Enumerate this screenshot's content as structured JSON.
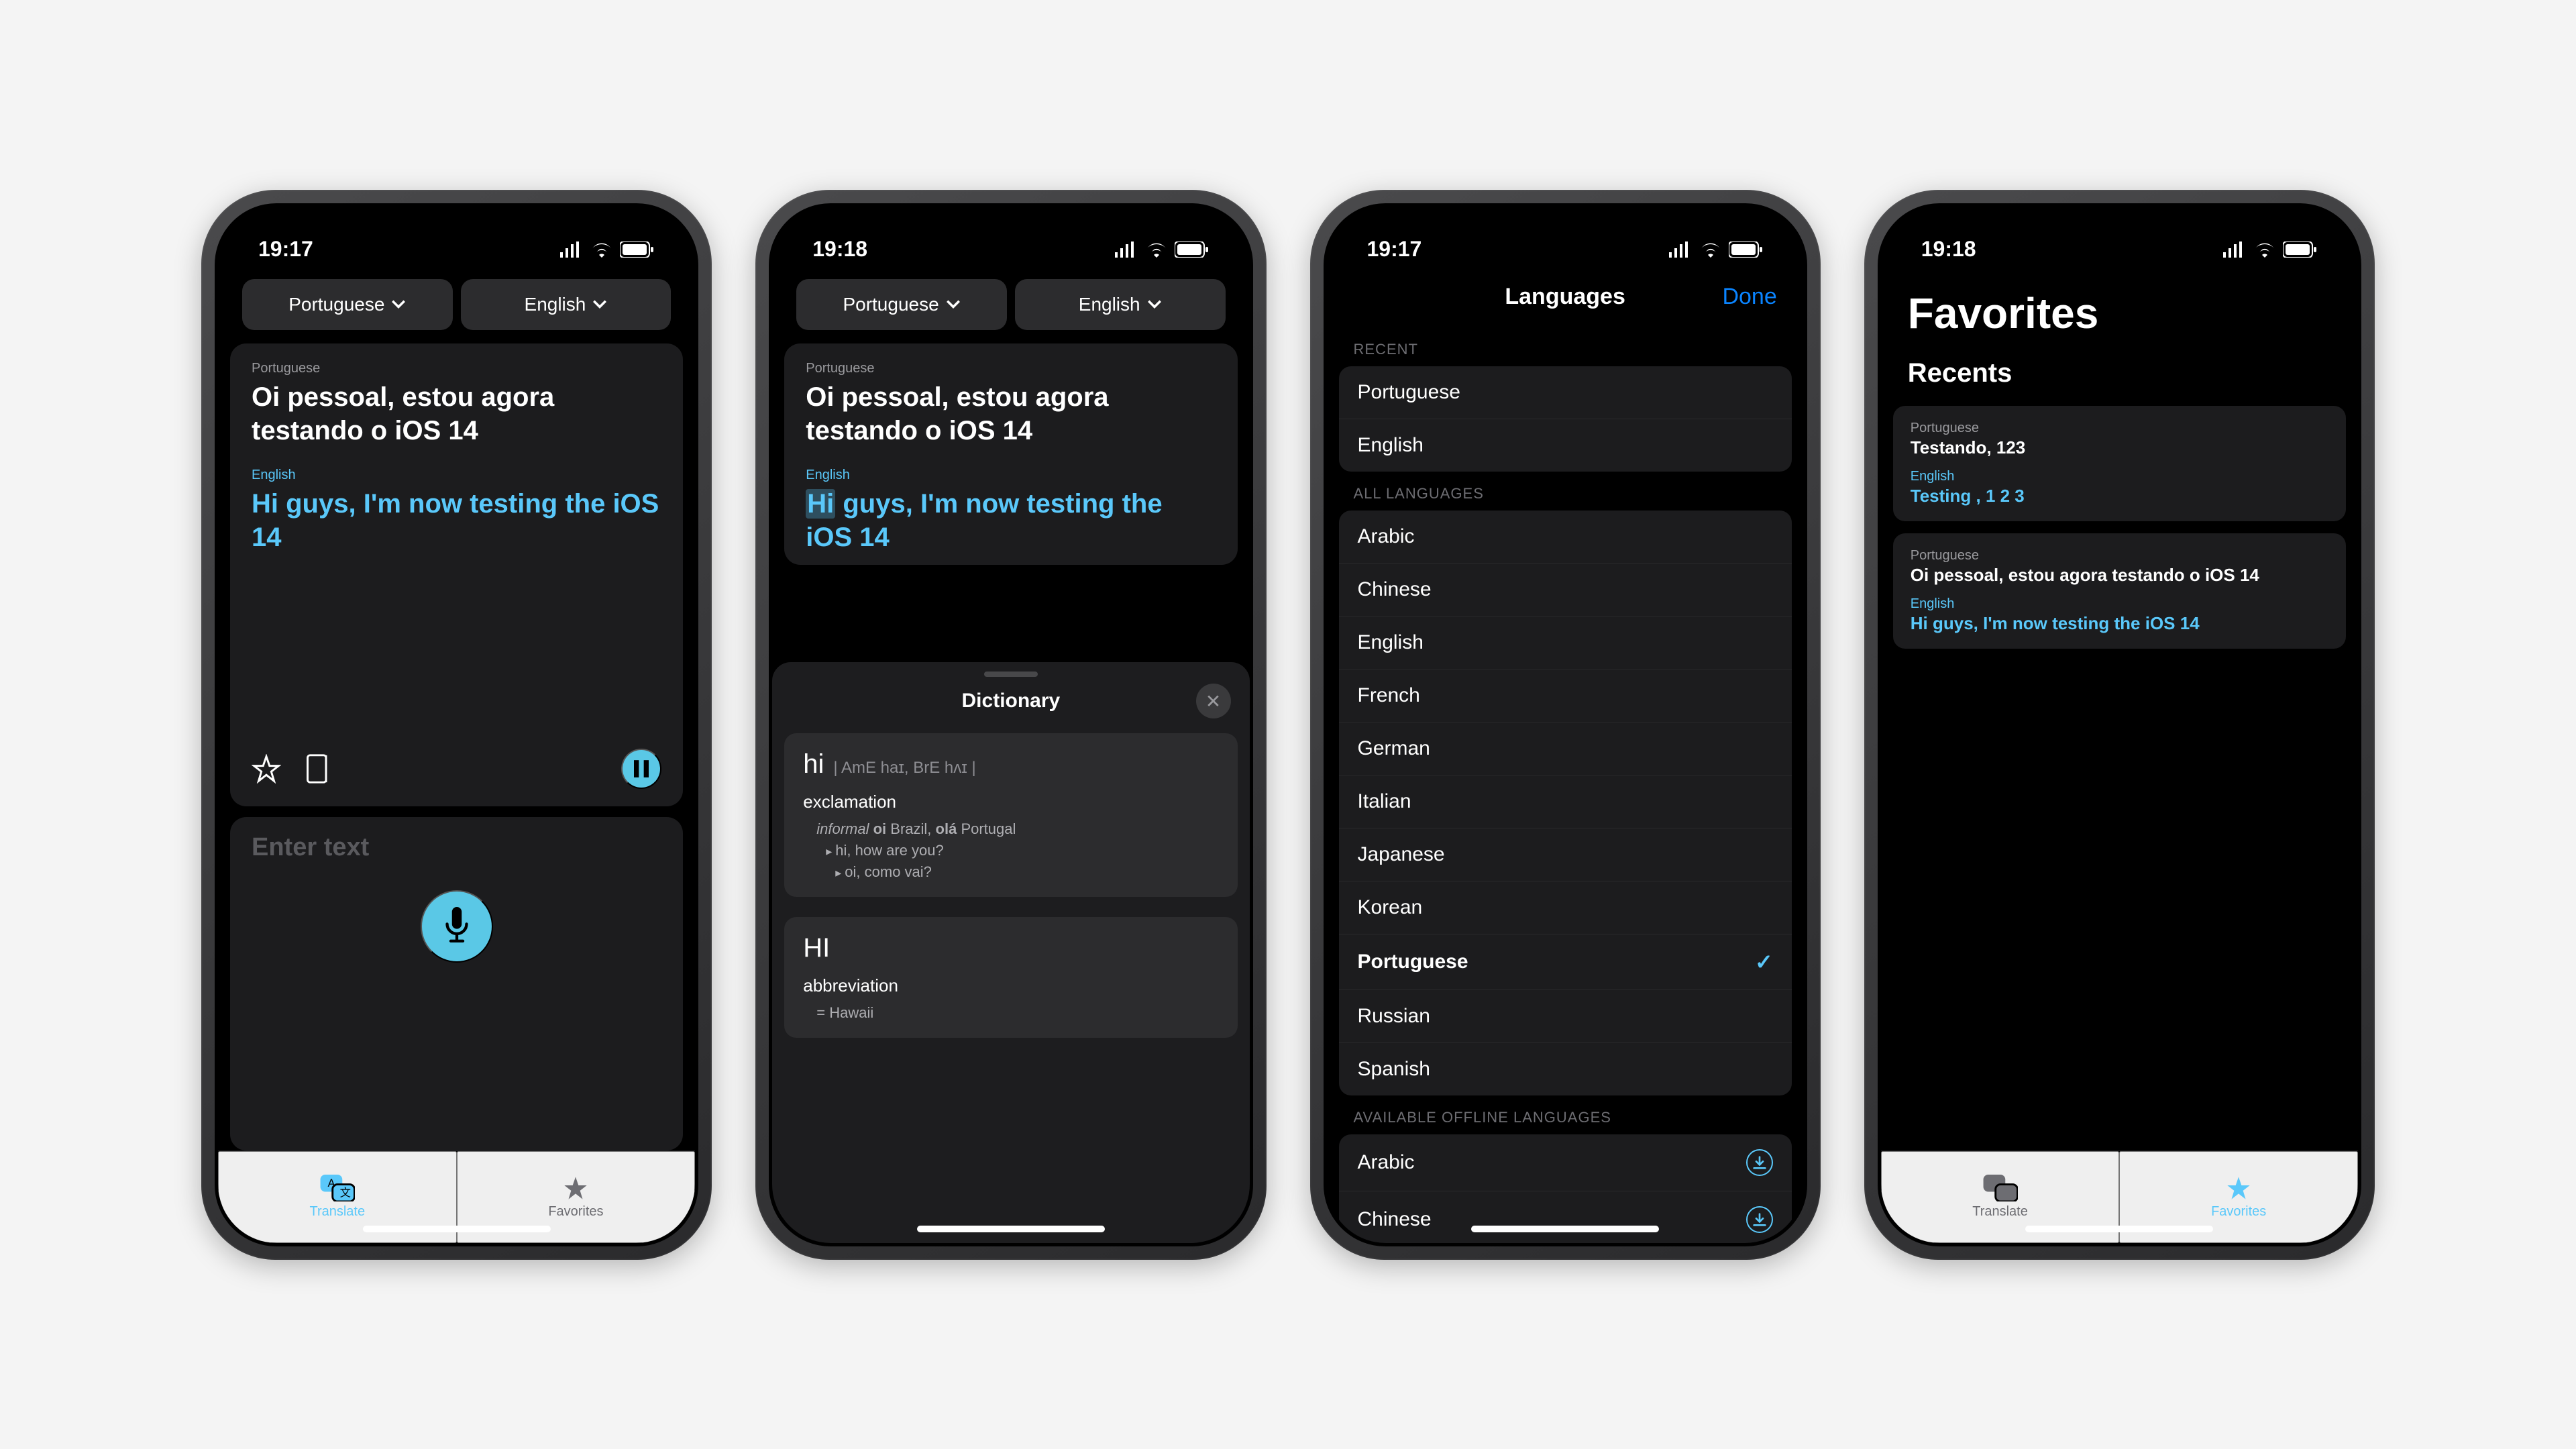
{
  "status": {
    "time_a": "19:17",
    "time_b": "19:18"
  },
  "langs": {
    "source": "Portuguese",
    "target": "English"
  },
  "translation": {
    "src_label": "Portuguese",
    "src_text": "Oi pessoal, estou agora testando o iOS 14",
    "tgt_label": "English",
    "tgt_hl": "Hi",
    "tgt_rest": " guys, I'm now testing the iOS 14",
    "tgt_full": "Hi guys, I'm now testing the iOS 14"
  },
  "input": {
    "placeholder": "Enter text"
  },
  "tabs": {
    "translate": "Translate",
    "favorites": "Favorites"
  },
  "dictionary": {
    "title": "Dictionary",
    "entries": [
      {
        "word": "hi",
        "pron": "| AmE haɪ, BrE hʌɪ |",
        "pos": "exclamation",
        "def_prefix": "informal ",
        "def_b1": "oi",
        "def_mid": " Brazil, ",
        "def_b2": "olá",
        "def_end": " Portugal",
        "ex1": "hi, how are you?",
        "ex2": "oi, como vai?"
      },
      {
        "word": "HI",
        "pos": "abbreviation",
        "def": "= Hawaii"
      }
    ]
  },
  "languages_screen": {
    "title": "Languages",
    "done": "Done",
    "section_recent": "RECENT",
    "section_all": "ALL LANGUAGES",
    "section_offline": "AVAILABLE OFFLINE LANGUAGES",
    "recent": [
      "Portuguese",
      "English"
    ],
    "all": [
      "Arabic",
      "Chinese",
      "English",
      "French",
      "German",
      "Italian",
      "Japanese",
      "Korean",
      "Portuguese",
      "Russian",
      "Spanish"
    ],
    "selected": "Portuguese",
    "offline": [
      "Arabic",
      "Chinese"
    ]
  },
  "favorites_screen": {
    "title": "Favorites",
    "subtitle": "Recents",
    "items": [
      {
        "src_label": "Portuguese",
        "src": "Testando, 123",
        "tgt_label": "English",
        "tgt": "Testing , 1 2 3"
      },
      {
        "src_label": "Portuguese",
        "src": "Oi pessoal, estou agora testando o iOS 14",
        "tgt_label": "English",
        "tgt": "Hi guys, I'm now testing the iOS 14"
      }
    ]
  }
}
